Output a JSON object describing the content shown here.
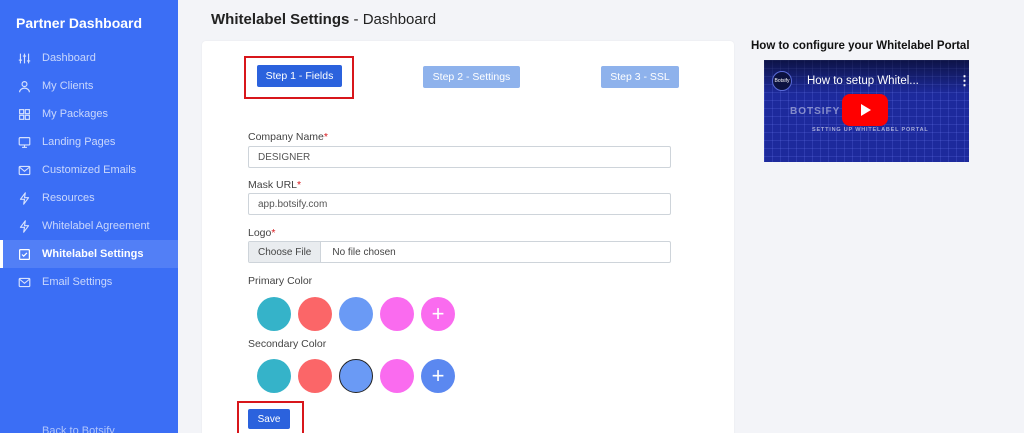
{
  "sidebar": {
    "brand": "Partner Dashboard",
    "items": [
      {
        "label": "Dashboard",
        "icon": "sliders-icon",
        "active": false
      },
      {
        "label": "My Clients",
        "icon": "user-icon",
        "active": false
      },
      {
        "label": "My Packages",
        "icon": "grid-icon",
        "active": false
      },
      {
        "label": "Landing Pages",
        "icon": "monitor-icon",
        "active": false
      },
      {
        "label": "Customized Emails",
        "icon": "mail-icon",
        "active": false
      },
      {
        "label": "Resources",
        "icon": "zap-icon",
        "active": false
      },
      {
        "label": "Whitelabel Agreement",
        "icon": "zap-icon",
        "active": false
      },
      {
        "label": "Whitelabel Settings",
        "icon": "check-square-icon",
        "active": true
      },
      {
        "label": "Email Settings",
        "icon": "mail-icon",
        "active": false
      }
    ],
    "bottom_label": "Back to Botsify"
  },
  "header": {
    "title": "Whitelabel Settings",
    "subtitle": " - Dashboard"
  },
  "steps": {
    "step1": "Step 1 - Fields",
    "step2": "Step 2 - Settings",
    "step3": "Step 3 - SSL"
  },
  "form": {
    "company_label": "Company Name",
    "company_value": "DESIGNER",
    "mask_label": "Mask URL",
    "mask_value": "app.botsify.com",
    "logo_label": "Logo",
    "file_button": "Choose File",
    "file_status": "No file chosen",
    "required_mark": "*",
    "primary_color_label": "Primary Color",
    "secondary_color_label": "Secondary Color",
    "add_symbol": "+",
    "save_label": "Save"
  },
  "colors": {
    "primary": [
      "#35b3c9",
      "#fb6668",
      "#6a9af5",
      "#fa6bef"
    ],
    "primary_add": "#fa6bef",
    "secondary": [
      "#35b3c9",
      "#fb6668",
      "#6a9af5",
      "#fa6bef"
    ],
    "secondary_add": "#5b88f0",
    "secondary_selected_index": 2,
    "accent": "#2b62dd",
    "sidebar": "#3b6ef5",
    "highlight": "#d8161b"
  },
  "help": {
    "title": "How to configure your Whitelabel Portal",
    "video_title": "How to setup Whitel...",
    "channel_badge": "Botsify",
    "video_overlay_text": "BOTSIFY VIDEO",
    "video_caption": "SETTING UP WHITELABEL PORTAL"
  }
}
